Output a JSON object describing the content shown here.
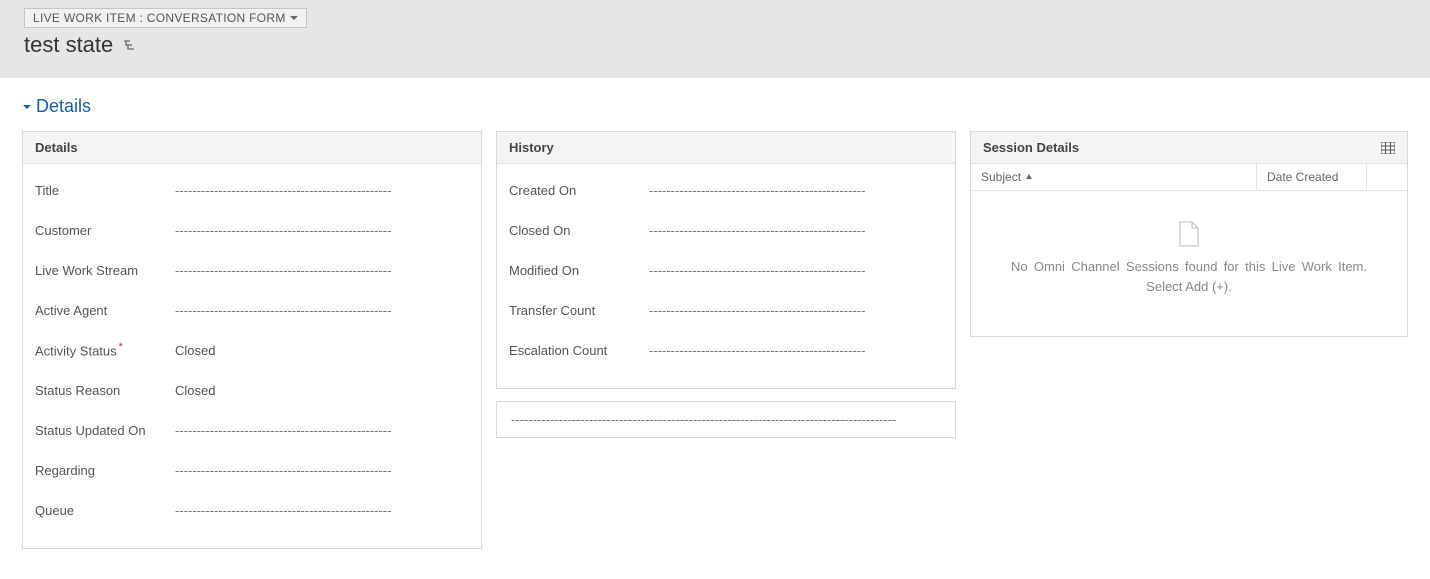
{
  "header": {
    "form_selector_label": "LIVE WORK ITEM : CONVERSATION FORM",
    "record_title": "test state"
  },
  "section": {
    "title": "Details"
  },
  "empty_field_placeholder": "--------------------------------------------------",
  "extra_box_placeholder": "-----------------------------------------------------------------------------------------",
  "details_panel": {
    "title": "Details",
    "fields": [
      {
        "label": "Title",
        "value": "",
        "required": false
      },
      {
        "label": "Customer",
        "value": "",
        "required": false
      },
      {
        "label": "Live Work Stream",
        "value": "",
        "required": false
      },
      {
        "label": "Active Agent",
        "value": "",
        "required": false
      },
      {
        "label": "Activity Status",
        "value": "Closed",
        "required": true
      },
      {
        "label": "Status Reason",
        "value": "Closed",
        "required": false
      },
      {
        "label": "Status Updated On",
        "value": "",
        "required": false
      },
      {
        "label": "Regarding",
        "value": "",
        "required": false
      },
      {
        "label": "Queue",
        "value": "",
        "required": false
      }
    ]
  },
  "history_panel": {
    "title": "History",
    "fields": [
      {
        "label": "Created On",
        "value": "",
        "required": false
      },
      {
        "label": "Closed On",
        "value": "",
        "required": false
      },
      {
        "label": "Modified On",
        "value": "",
        "required": false
      },
      {
        "label": "Transfer Count",
        "value": "",
        "required": false
      },
      {
        "label": "Escalation Count",
        "value": "",
        "required": false
      }
    ]
  },
  "session_panel": {
    "title": "Session Details",
    "columns": {
      "subject": "Subject",
      "date_created": "Date Created"
    },
    "empty_message": "No Omni Channel Sessions found for this Live Work Item. Select Add (+)."
  }
}
